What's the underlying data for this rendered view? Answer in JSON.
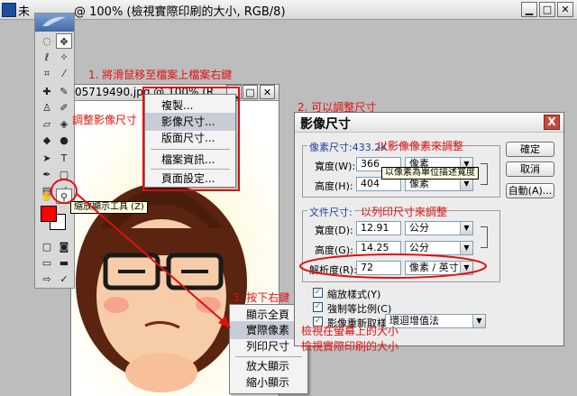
{
  "main_window": {
    "title_left": "未",
    "title_right": "@ 100% (檢視實際印刷的大小, RGB/8)"
  },
  "document": {
    "title": "05719490.jpg @ 100% (R"
  },
  "context_menu_1": {
    "items": [
      "複製...",
      "影像尺寸...",
      "版面尺寸...",
      "檔案資訊...",
      "頁面設定..."
    ],
    "highlighted": 1
  },
  "context_menu_2": {
    "items": [
      "顯示全頁",
      "實際像素",
      "列印尺寸",
      "放大顯示",
      "縮小顯示"
    ],
    "highlighted": 1
  },
  "dialog": {
    "title": "影像尺寸",
    "close_label": "X",
    "pixel_group_label": "像素尺寸:433.2K",
    "pixel_width_label": "寬度(W):",
    "pixel_width_value": "366",
    "pixel_width_unit": "像素",
    "pixel_height_label": "高度(H):",
    "pixel_height_value": "404",
    "pixel_height_unit": "像素",
    "doc_group_label": "文件尺寸:",
    "doc_width_label": "寬度(D):",
    "doc_width_value": "12.91",
    "doc_width_unit": "公分",
    "doc_height_label": "高度(G):",
    "doc_height_value": "14.25",
    "doc_height_unit": "公分",
    "resolution_label": "解析度(R):",
    "resolution_value": "72",
    "resolution_unit": "像素 / 英寸",
    "scale_styles": "縮放樣式(Y)",
    "constrain": "強制等比例(C)",
    "resample": "影像重新取樣(I):",
    "resample_method": "環迴增值法",
    "ok": "確定",
    "cancel": "取消",
    "auto": "自動(A)..."
  },
  "tooltips": {
    "pixel_unit_tip": "以像素為單位描述寬度",
    "zoom_tool_tip": "縮放顯示工具 (Z)"
  },
  "annotations": {
    "step1": "1. 將滑鼠移至檔案上檔案右鍵",
    "step2": "2. 可以調整尺寸",
    "step3": "3. 按下右鍵",
    "adjust_image_size": "調整影像尺寸",
    "by_pixel": "以影像像素來調整",
    "by_print": "以列印尺寸來調整",
    "view_screen_size": "檢視在螢幕上的大小",
    "view_print_size": "檢視實際印刷的大小"
  },
  "colors": {
    "annotation": "#e01010",
    "foreground_swatch": "#ff0000",
    "dialog_group_label": "#1d3f95"
  }
}
